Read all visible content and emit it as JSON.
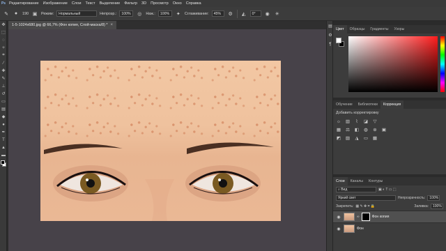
{
  "menu": {
    "items": [
      "Редактирование",
      "Изображение",
      "Слои",
      "Текст",
      "Выделение",
      "Фильтр",
      "3D",
      "Просмотр",
      "Окно",
      "Справка"
    ]
  },
  "options": {
    "brush_size": "190",
    "mode_label": "Режим:",
    "mode_value": "Нормальный",
    "opacity_label": "Непрозр.:",
    "opacity_value": "100%",
    "pressure_label": "Наж.:",
    "pressure_value": "100%",
    "smoothing_label": "Сглаживание:",
    "smoothing_value": "45%",
    "angle_value": "0°"
  },
  "document": {
    "tab_title": "1-5-1024x680.jpg @ 66,7% (Фон копия, Слой-маска/8) *",
    "close_glyph": "×"
  },
  "color_panel": {
    "tabs": [
      "Цвет",
      "Образцы",
      "Градиенты",
      "Узоры"
    ],
    "active_tab": 0
  },
  "adjustments_panel": {
    "tabs": [
      "Обучение",
      "Библиотеки",
      "Коррекция"
    ],
    "active_tab": 2,
    "title": "Добавить корректировку"
  },
  "layers_panel": {
    "tabs": [
      "Слои",
      "Каналы",
      "Контуры"
    ],
    "active_tab": 0,
    "filter_kind": "Вид",
    "blend_mode": "Яркий свет",
    "opacity_label": "Непрозрачность:",
    "opacity_value": "100%",
    "lock_label": "Закрепить:",
    "fill_label": "Заливка:",
    "fill_value": "100%",
    "layers": [
      {
        "name": "Фон копия",
        "visible": true,
        "selected": true
      },
      {
        "name": "Фон",
        "visible": true,
        "selected": false
      }
    ]
  },
  "colors": {
    "accent": "#3c3c3c",
    "workspace": "#474249",
    "foreground": "#ffffff",
    "background": "#000000"
  }
}
